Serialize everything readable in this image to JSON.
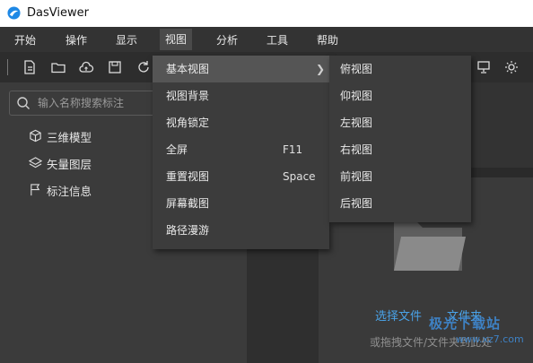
{
  "window": {
    "title": "DasViewer"
  },
  "menubar": {
    "items": [
      {
        "label": "开始"
      },
      {
        "label": "操作"
      },
      {
        "label": "显示"
      },
      {
        "label": "视图"
      },
      {
        "label": "分析"
      },
      {
        "label": "工具"
      },
      {
        "label": "帮助"
      }
    ],
    "active": "视图"
  },
  "toolbar": {
    "icons": [
      "new-file-icon",
      "open-folder-icon",
      "cloud-icon",
      "save-icon",
      "refresh-icon",
      "monitor-icon",
      "brightness-icon"
    ]
  },
  "search": {
    "placeholder": "输入名称搜索标注"
  },
  "tree": {
    "items": [
      {
        "label": "三维模型",
        "icon": "cube-icon"
      },
      {
        "label": "矢量图层",
        "icon": "layers-icon"
      },
      {
        "label": "标注信息",
        "icon": "flag-icon"
      }
    ]
  },
  "view_menu": {
    "items": [
      {
        "label": "基本视图",
        "shortcut": "",
        "has_submenu": true,
        "highlighted": true
      },
      {
        "label": "视图背景",
        "shortcut": ""
      },
      {
        "label": "视角锁定",
        "shortcut": ""
      },
      {
        "label": "全屏",
        "shortcut": "F11"
      },
      {
        "label": "重置视图",
        "shortcut": "Space"
      },
      {
        "label": "屏幕截图",
        "shortcut": ""
      },
      {
        "label": "路径漫游",
        "shortcut": ""
      }
    ]
  },
  "basic_view_submenu": {
    "items": [
      {
        "label": "俯视图"
      },
      {
        "label": "仰视图"
      },
      {
        "label": "左视图"
      },
      {
        "label": "右视图"
      },
      {
        "label": "前视图"
      },
      {
        "label": "后视图"
      }
    ]
  },
  "drop_zone": {
    "select_file": "选择文件",
    "folder": "文件夹",
    "hint": "或拖拽文件/文件夹到此处"
  },
  "watermark": {
    "text": "极光下载站",
    "url": "www.xz7.com"
  },
  "colors": {
    "link": "#4aa3e8",
    "menu_bg": "#3c3c3c",
    "highlight": "#555555"
  }
}
